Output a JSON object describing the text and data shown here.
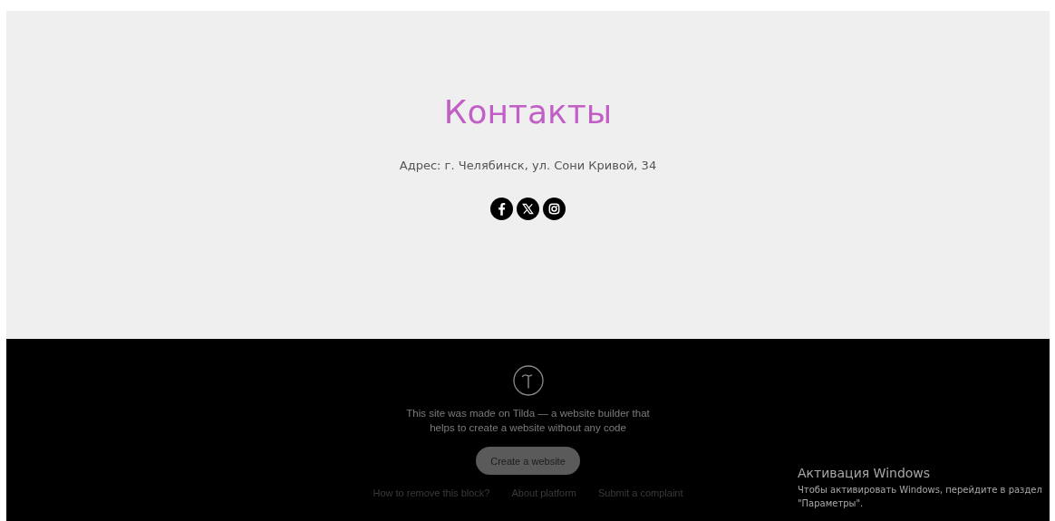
{
  "contacts": {
    "title": "Контакты",
    "address": "Адрес: г. Челябинск, ул. Сони Кривой, 34",
    "socials": [
      {
        "kind": "facebook"
      },
      {
        "kind": "x"
      },
      {
        "kind": "instagram"
      }
    ]
  },
  "footer": {
    "text": "This site was made on Tilda — a website builder that helps to create a website without any code",
    "button": "Create a website",
    "links": [
      "How to remove this block?",
      "About platform",
      "Submit a complaint"
    ]
  },
  "activation": {
    "title": "Активация Windows",
    "text": "Чтобы активировать Windows, перейдите в раздел \"Параметры\"."
  }
}
